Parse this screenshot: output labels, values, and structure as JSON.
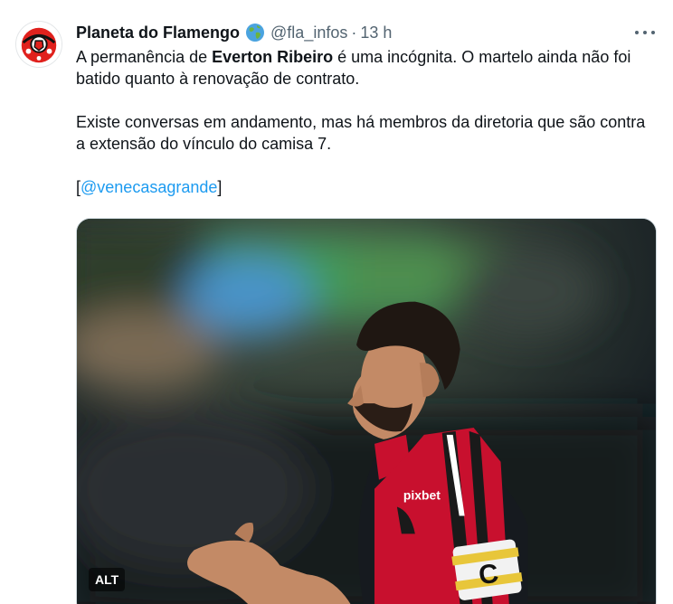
{
  "tweet": {
    "display_name": "Planeta do Flamengo",
    "handle": "@fla_infos",
    "separator": "·",
    "time": "13 h",
    "verified_icon": "globe-icon",
    "more_icon": "more-icon",
    "text": {
      "p1_before": "A permanência de ",
      "p1_bold": "Everton Ribeiro",
      "p1_after": " é uma incógnita. O martelo ainda não foi batido quanto à renovação de contrato.",
      "p2": "Existe conversas em andamento, mas há membros da diretoria que são contra a extensão do vínculo do camisa 7.",
      "p3_open": "[",
      "p3_mention": "@venecasagrande",
      "p3_close": "]"
    },
    "media": {
      "alt_label": "ALT",
      "jersey_text": "pixbet",
      "armband_letter": "C"
    }
  },
  "colors": {
    "text": "#0f1419",
    "secondary": "#536471",
    "link": "#1d9bf0",
    "avatar_red": "#e0211d",
    "jersey_red": "#c8102e"
  }
}
